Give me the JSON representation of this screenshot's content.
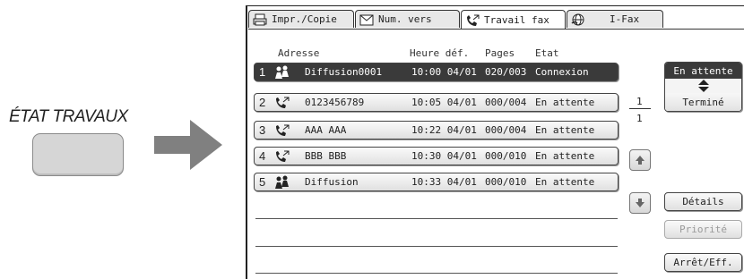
{
  "left": {
    "label": "ÉTAT TRAVAUX"
  },
  "tabs": [
    {
      "label": "Impr./Copie",
      "icon": "printer-icon",
      "active": false
    },
    {
      "label": "Num. vers",
      "icon": "scan-send-icon",
      "active": false
    },
    {
      "label": "Travail fax",
      "icon": "fax-phone-icon",
      "active": true
    },
    {
      "label": "I-Fax",
      "icon": "globe-icon",
      "active": false
    }
  ],
  "columns": {
    "address": "Adresse",
    "time": "Heure déf.",
    "pages": "Pages",
    "state": "Etat"
  },
  "jobs": [
    {
      "num": "1",
      "icon": "broadcast-icon",
      "address": "Diffusion0001",
      "time": "10:00 04/01",
      "pages": "020/003",
      "state": "Connexion"
    },
    {
      "num": "2",
      "icon": "phone-icon",
      "address": "0123456789",
      "time": "10:05 04/01",
      "pages": "000/004",
      "state": "En attente"
    },
    {
      "num": "3",
      "icon": "phone-icon",
      "address": "AAA AAA",
      "time": "10:22 04/01",
      "pages": "000/004",
      "state": "En attente"
    },
    {
      "num": "4",
      "icon": "phone-icon",
      "address": "BBB BBB",
      "time": "10:30 04/01",
      "pages": "000/010",
      "state": "En attente"
    },
    {
      "num": "5",
      "icon": "broadcast-icon",
      "address": "Diffusion",
      "time": "10:33 04/01",
      "pages": "000/010",
      "state": "En attente"
    }
  ],
  "pager": {
    "current": "1",
    "total": "1"
  },
  "queue_toggle": {
    "selected": "En attente",
    "other": "Terminé"
  },
  "buttons": {
    "details": "Détails",
    "priority": "Priorité",
    "stop_delete": "Arrêt/Eff."
  },
  "colors": {
    "selected_row": "#3a3a3a",
    "disabled_text": "#9a9a9a"
  }
}
